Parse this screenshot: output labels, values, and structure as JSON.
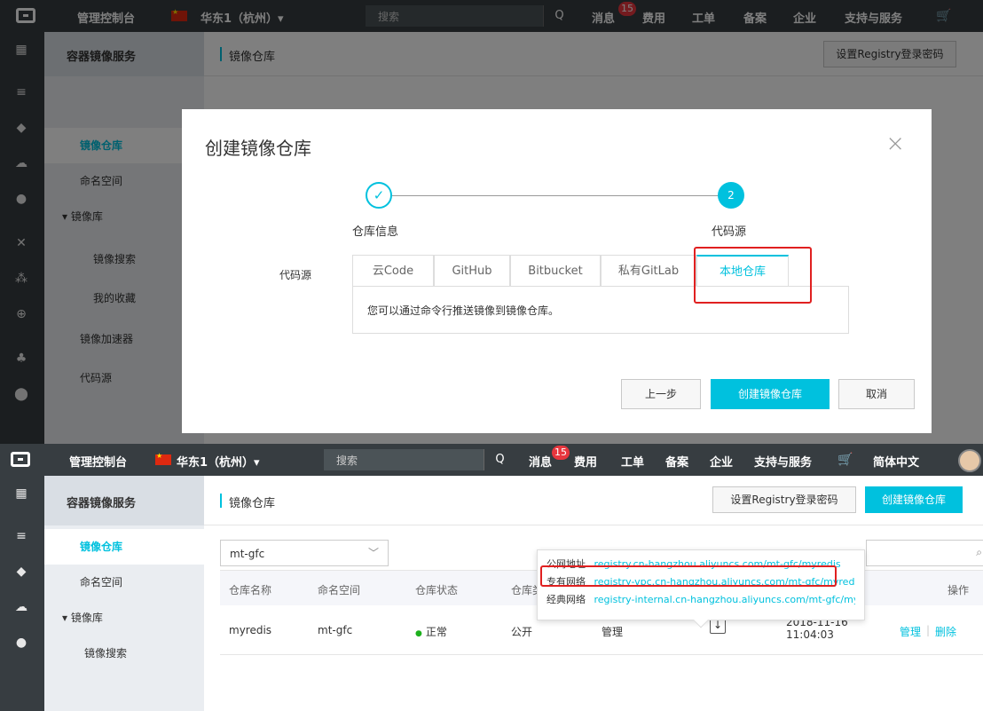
{
  "topbar": {
    "console": "管理控制台",
    "region": "华东1（杭州）▾",
    "search_placeholder": "搜索",
    "search_icon": "Q",
    "messages": "消息",
    "message_count": "15",
    "fees": "费用",
    "tickets": "工单",
    "filing": "备案",
    "enterprise": "企业",
    "support": "支持与服务",
    "language": "简体中文"
  },
  "sidebar": {
    "title": "容器镜像服务",
    "items": [
      {
        "label": "镜像仓库"
      },
      {
        "label": "命名空间"
      },
      {
        "label": "▾ 镜像库"
      },
      {
        "label": "镜像搜索"
      },
      {
        "label": "我的收藏"
      },
      {
        "label": "镜像加速器"
      },
      {
        "label": "代码源"
      }
    ]
  },
  "content": {
    "title": "镜像仓库",
    "registry_password_button": "设置Registry登录密码",
    "create_button": "创建镜像仓库"
  },
  "modal": {
    "title": "创建镜像仓库",
    "close": "×",
    "step1_label": "仓库信息",
    "step1_icon": "✓",
    "step2_number": "2",
    "step2_label": "代码源",
    "code_source_label": "代码源",
    "tabs": [
      {
        "label": "云Code"
      },
      {
        "label": "GitHub"
      },
      {
        "label": "Bitbucket"
      },
      {
        "label": "私有GitLab"
      },
      {
        "label": "本地仓库"
      }
    ],
    "panel_text": "您可以通过命令行推送镜像到镜像仓库。",
    "prev_button": "上一步",
    "create_button": "创建镜像仓库",
    "cancel_button": "取消"
  },
  "list": {
    "namespace_filter": "mt-gfc",
    "columns": [
      "仓库名称",
      "命名空间",
      "仓库状态",
      "仓库类",
      "操作"
    ],
    "row": {
      "name": "myredis",
      "namespace": "mt-gfc",
      "status": "正常",
      "type": "公开",
      "manage_label": "管理",
      "created_date": "2018-11-16",
      "created_time": "11:04:03",
      "action_manage": "管理",
      "action_sep": "|",
      "action_delete": "删除"
    },
    "popup": [
      {
        "key": "公网地址",
        "value": "registry.cn-hangzhou.aliyuncs.com/mt-gfc/myredis"
      },
      {
        "key": "专有网络",
        "value": "registry-vpc.cn-hangzhou.aliyuncs.com/mt-gfc/myredis"
      },
      {
        "key": "经典网络",
        "value": "registry-internal.cn-hangzhou.aliyuncs.com/mt-gfc/myrec"
      }
    ]
  },
  "colors": {
    "accent": "#00c1de",
    "topbar": "#373d41",
    "highlight": "#e02020"
  }
}
